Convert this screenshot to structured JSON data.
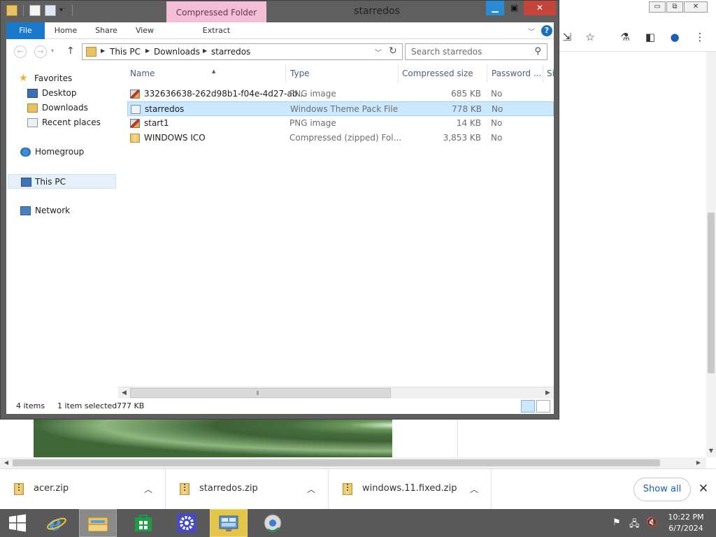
{
  "browser": {
    "window_controls": [
      "▭",
      "⧉",
      "✕"
    ],
    "toolbar_icons": [
      "install-app-icon",
      "bookmark-star-icon",
      "labs-flask-icon",
      "side-panel-icon",
      "profile-icon",
      "menu-icon"
    ]
  },
  "downloads": {
    "items": [
      {
        "name": "acer.zip"
      },
      {
        "name": "starredos.zip"
      },
      {
        "name": "windows.11.fixed.zip"
      }
    ],
    "show_all": "Show all"
  },
  "explorer": {
    "title": "starredos",
    "context_tab": "Compressed Folder Tools",
    "ribbon_tabs": [
      "File",
      "Home",
      "Share",
      "View",
      "Extract"
    ],
    "address": {
      "crumbs": [
        "This PC",
        "Downloads",
        "starredos"
      ]
    },
    "search_placeholder": "Search starredos",
    "nav_pane": {
      "favorites": "Favorites",
      "desktop": "Desktop",
      "downloads": "Downloads",
      "recent": "Recent places",
      "homegroup": "Homegroup",
      "thispc": "This PC",
      "network": "Network"
    },
    "columns": [
      "Name",
      "Type",
      "Compressed size",
      "Password ...",
      "Si"
    ],
    "files": [
      {
        "name": "332636638-262d98b1-f04e-4d27-ab...",
        "type": "PNG image",
        "size": "685 KB",
        "password": "No",
        "icon": "png"
      },
      {
        "name": "starredos",
        "type": "Windows Theme Pack File",
        "size": "778 KB",
        "password": "No",
        "icon": "theme",
        "selected": true
      },
      {
        "name": "start1",
        "type": "PNG image",
        "size": "14 KB",
        "password": "No",
        "icon": "png"
      },
      {
        "name": "WINDOWS ICO",
        "type": "Compressed (zipped) Fol...",
        "size": "3,853 KB",
        "password": "No",
        "icon": "zip"
      }
    ],
    "status": {
      "count": "4 items",
      "selection": "1 item selected",
      "selection_size": "777 KB"
    }
  },
  "taskbar": {
    "clock_time": "10:22 PM",
    "clock_date": "6/7/2024"
  },
  "colors": {
    "accent": "#1979ca",
    "context_tab": "#f2bfd7",
    "close": "#c7443a",
    "taskbar": "#595959"
  }
}
